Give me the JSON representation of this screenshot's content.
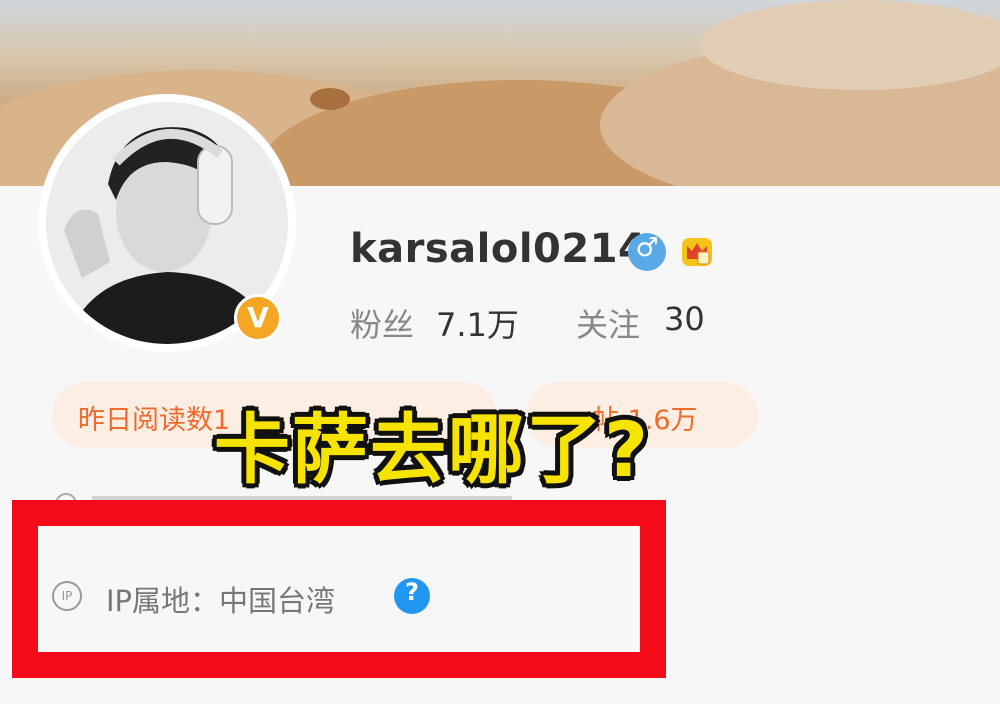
{
  "profile": {
    "username": "karsalol0214",
    "gender_icon": "male-icon",
    "member_icon": "crown-icon",
    "verified_badge": "V",
    "stats": {
      "fans_label": "粉丝",
      "fans_value": "7.1万",
      "follow_label": "关注",
      "follow_value": "30"
    }
  },
  "pills": {
    "yesterday_reads": "昨日阅读数1",
    "posts": "帖 1.6万"
  },
  "overlay_caption": "卡萨去哪了?",
  "ip": {
    "icon_text": "IP",
    "label": "IP属地：中国台湾",
    "help_icon_text": "?"
  },
  "colors": {
    "accent_orange": "#f06a2c",
    "pill_bg": "#fdeee4",
    "verified_gold": "#f5a623",
    "male_blue": "#5aa9e6",
    "help_blue": "#2196f3",
    "highlight_red": "#f40a18",
    "caption_yellow": "#f7e300"
  }
}
